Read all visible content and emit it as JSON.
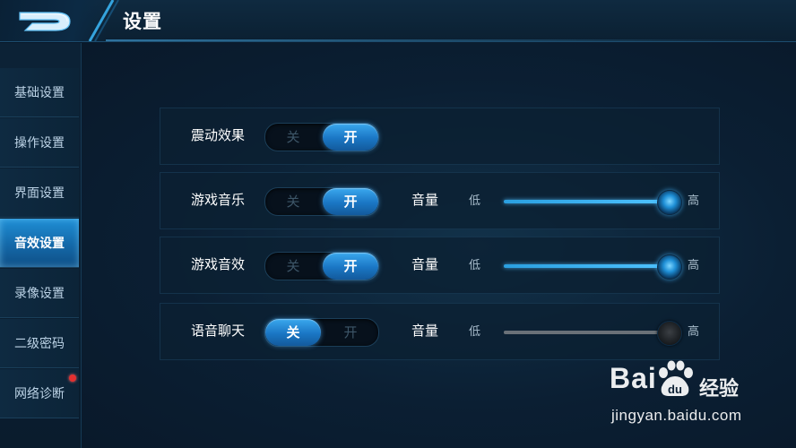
{
  "header": {
    "title": "设置"
  },
  "sidebar": {
    "items": [
      {
        "label": "基础设置",
        "active": false,
        "badge": false
      },
      {
        "label": "操作设置",
        "active": false,
        "badge": false
      },
      {
        "label": "界面设置",
        "active": false,
        "badge": false
      },
      {
        "label": "音效设置",
        "active": true,
        "badge": false
      },
      {
        "label": "录像设置",
        "active": false,
        "badge": false
      },
      {
        "label": "二级密码",
        "active": false,
        "badge": false
      },
      {
        "label": "网络诊断",
        "active": false,
        "badge": true
      }
    ]
  },
  "settings": {
    "rows": [
      {
        "label": "震动效果",
        "toggle_off": "关",
        "toggle_on": "开",
        "value": "开"
      },
      {
        "label": "游戏音乐",
        "toggle_off": "关",
        "toggle_on": "开",
        "value": "开",
        "volume_label": "音量",
        "low_label": "低",
        "high_label": "高",
        "volume_percent": 100
      },
      {
        "label": "游戏音效",
        "toggle_off": "关",
        "toggle_on": "开",
        "value": "开",
        "volume_label": "音量",
        "low_label": "低",
        "high_label": "高",
        "volume_percent": 100
      },
      {
        "label": "语音聊天",
        "toggle_off": "关",
        "toggle_on": "开",
        "value": "关",
        "volume_label": "音量",
        "low_label": "低",
        "high_label": "高",
        "volume_percent": 100
      }
    ]
  },
  "watermark": {
    "brand_left": "Bai",
    "brand_right": "经验",
    "url": "jingyan.baidu.com"
  },
  "icons": {
    "back": "back-arrow-icon",
    "notification": "red-dot-badge",
    "watermark_logo": "baidu-paw-icon"
  },
  "colors": {
    "accent": "#1a76c4",
    "active_tab": "#1f8fd6",
    "badge": "#e23030",
    "background": "#0b1f33"
  }
}
